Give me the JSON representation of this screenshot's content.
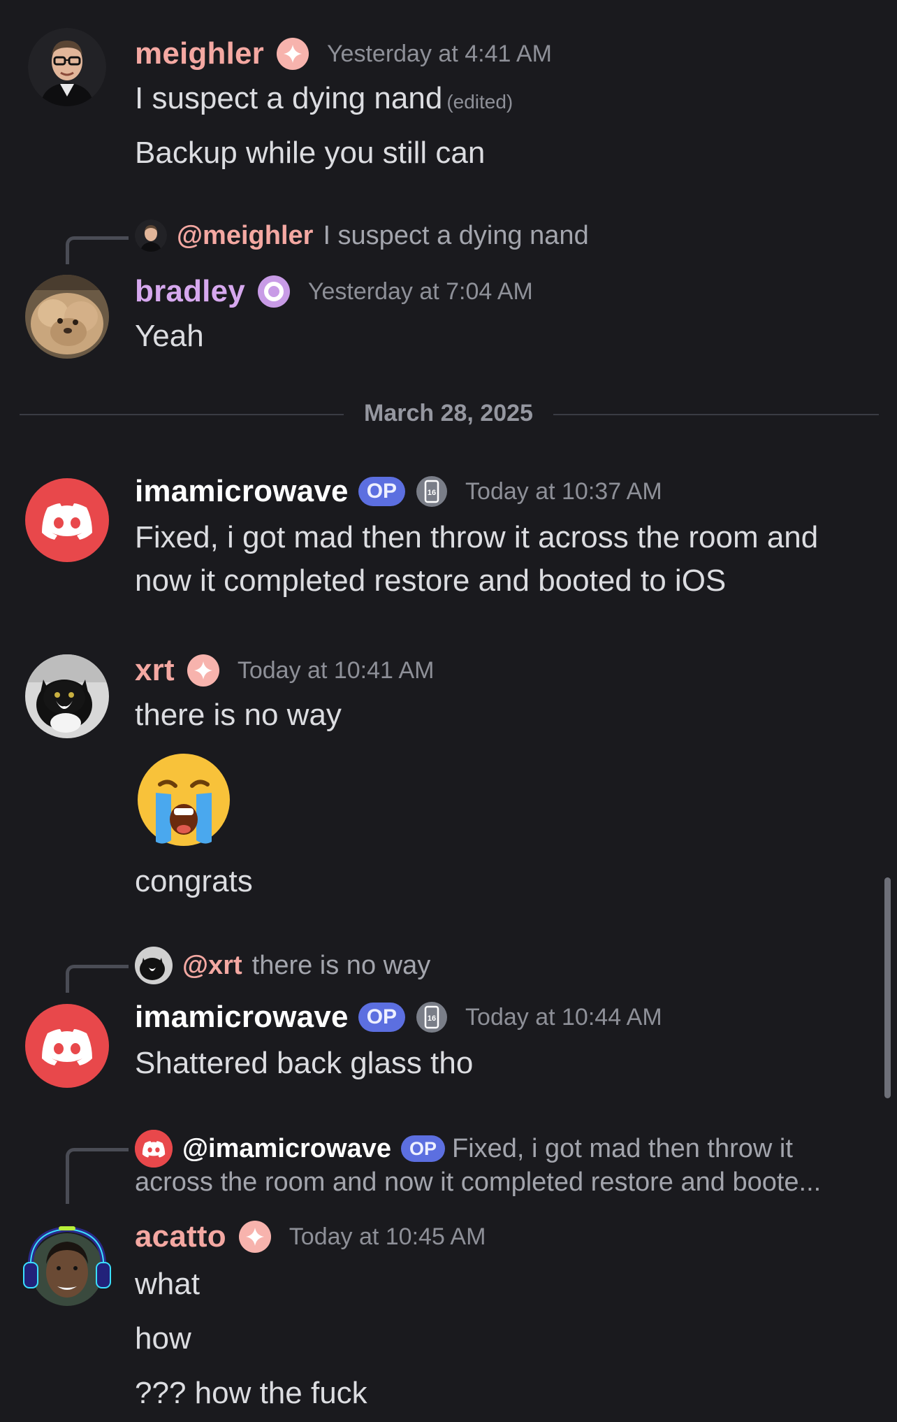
{
  "colors": {
    "background": "#1a1a1e",
    "meighler": "#f4a8a2",
    "bradley": "#d6a8ee",
    "acatto": "#f4a8a2",
    "xrt": "#f4a8a2",
    "imamicrowave": "#ffffff",
    "op_badge": "#5c6fe0",
    "discord_red": "#e8484b"
  },
  "messages": [
    {
      "username": "meighler",
      "badge": "sparkle-icon",
      "timestamp": "Yesterday at 4:41 AM",
      "lines": [
        "I suspect a dying nand",
        "Backup while you still can"
      ],
      "edited_label": "(edited)"
    },
    {
      "reply": {
        "mention": "@meighler",
        "text": "I suspect a dying nand"
      },
      "username": "bradley",
      "badge": "ring-icon",
      "timestamp": "Yesterday at 7:04 AM",
      "lines": [
        "Yeah"
      ]
    },
    {
      "username": "imamicrowave",
      "op_label": "OP",
      "device_badge": "16",
      "timestamp": "Today at 10:37 AM",
      "lines": [
        "Fixed, i got mad then throw it across the room and",
        "now it completed restore and booted to iOS"
      ]
    },
    {
      "username": "xrt",
      "badge": "sparkle-icon",
      "timestamp": "Today at 10:41 AM",
      "lines": [
        "there is no way",
        "congrats"
      ],
      "emoji": "😭"
    },
    {
      "reply": {
        "mention": "@xrt",
        "text": "there is no way"
      },
      "username": "imamicrowave",
      "op_label": "OP",
      "device_badge": "16",
      "timestamp": "Today at 10:44 AM",
      "lines": [
        "Shattered back glass tho"
      ]
    },
    {
      "reply": {
        "mention": "@imamicrowave",
        "op_label": "OP",
        "text": "Fixed, i got mad then throw it",
        "text_line2": "across the room and now it completed restore and boote..."
      },
      "username": "acatto",
      "badge": "sparkle-icon",
      "timestamp": "Today at 10:45 AM",
      "lines": [
        "what",
        "how",
        "??? how the fuck"
      ]
    }
  ],
  "date_divider": "March 28, 2025"
}
